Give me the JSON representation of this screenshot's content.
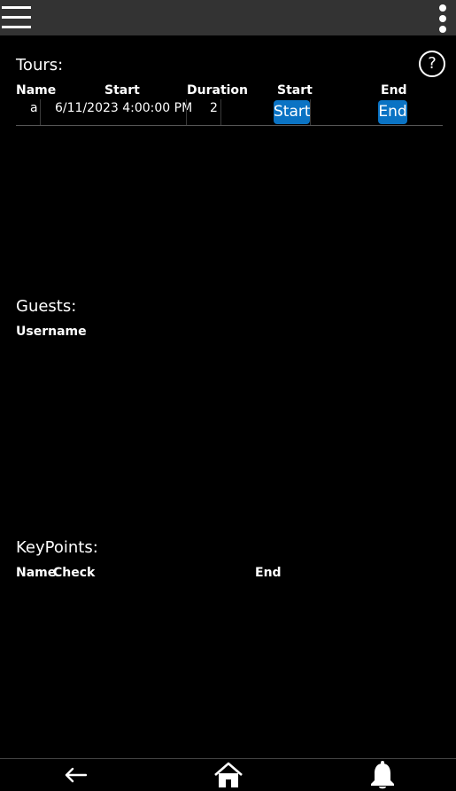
{
  "menu_icon": "hamburger-menu-icon",
  "overflow_icon": "more-vert-icon",
  "help_label": "?",
  "tours": {
    "title": "Tours:",
    "columns": {
      "name": "Name",
      "start": "Start",
      "duration": "Duration",
      "start_action": "Start",
      "end_action": "End"
    },
    "rows": [
      {
        "name": "a",
        "start": "6/11/2023 4:00:00 PM",
        "duration": "2",
        "start_button": "Start",
        "end_button": "End"
      }
    ]
  },
  "guests": {
    "title": "Guests:",
    "columns": {
      "username": "Username"
    }
  },
  "keypoints": {
    "title": "KeyPoints:",
    "columns": {
      "name": "Name",
      "check": "Check",
      "end": "End"
    }
  },
  "bottom_nav": {
    "back_icon": "arrow-left-icon",
    "home_icon": "home-icon",
    "notifications_icon": "bell-icon"
  },
  "colors": {
    "accent": "#0a73c4",
    "topbar": "#333333",
    "background": "#000000"
  }
}
